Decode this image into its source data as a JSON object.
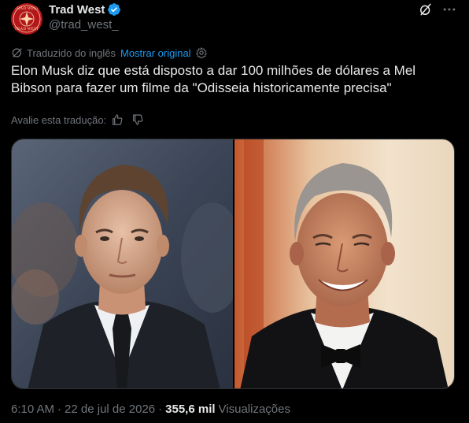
{
  "author": {
    "display_name": "Trad West",
    "handle": "@trad_west_",
    "verified": true,
    "avatar_text_top": "TRAD WEST",
    "avatar_text_bottom": "TRAD WEST"
  },
  "actions": {
    "grok_icon": "grok-slash-icon",
    "more_icon": "more-dots-icon"
  },
  "translation": {
    "label": "Traduzido do inglês",
    "show_original": "Mostrar original",
    "rate_label": "Avalie esta tradução:"
  },
  "tweet": {
    "text": "Elon Musk diz que está disposto a dar 100 milhões de dólares a Mel Bibson para fazer um filme da \"Odisseia historicamente precisa\""
  },
  "meta": {
    "time": "6:10 AM",
    "date": "22 de jul de 2026",
    "separator": "·",
    "views_count": "355,6 mil",
    "views_label": "Visualizações"
  },
  "colors": {
    "background": "#000000",
    "text": "#e7e9ea",
    "secondary": "#71767b",
    "accent": "#1d9bf0",
    "avatar_red": "#b3171c"
  }
}
